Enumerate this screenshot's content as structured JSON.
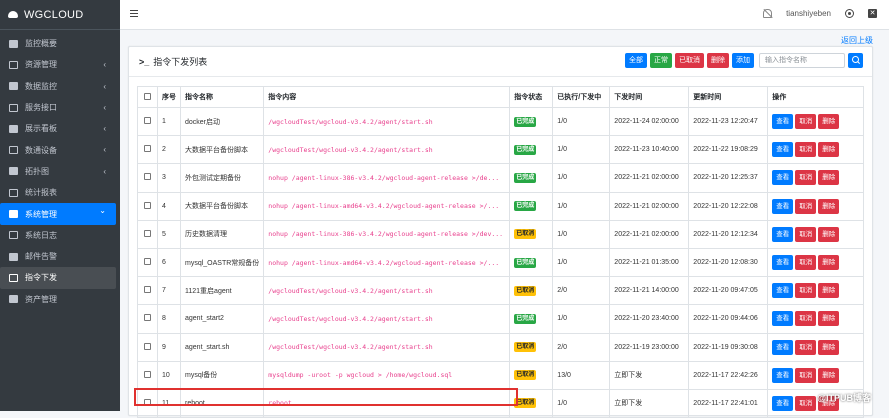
{
  "brand": "WGCLOUD",
  "sidebar": {
    "items": [
      {
        "label": "监控概要",
        "icon": "dashboard-icon",
        "arrow": false
      },
      {
        "label": "资源管理",
        "icon": "database-icon",
        "arrow": true
      },
      {
        "label": "数据监控",
        "icon": "chart-icon",
        "arrow": true
      },
      {
        "label": "服务接口",
        "icon": "link-icon",
        "arrow": true
      },
      {
        "label": "展示看板",
        "icon": "board-icon",
        "arrow": true
      },
      {
        "label": "数通设备",
        "icon": "network-icon",
        "arrow": true
      },
      {
        "label": "拓扑图",
        "icon": "topology-icon",
        "arrow": true
      },
      {
        "label": "统计报表",
        "icon": "pie-icon",
        "arrow": false
      },
      {
        "label": "系统管理",
        "icon": "system-icon",
        "arrow": true
      },
      {
        "label": "系统日志",
        "icon": "log-icon",
        "arrow": false
      },
      {
        "label": "邮件告警",
        "icon": "mail-icon",
        "arrow": false
      },
      {
        "label": "指令下发",
        "icon": "terminal-icon",
        "arrow": false
      },
      {
        "label": "资产管理",
        "icon": "asset-icon",
        "arrow": false
      }
    ]
  },
  "topbar": {
    "username": "tianshiyeben"
  },
  "back_link": "返回上级",
  "card": {
    "title": "指令下发列表",
    "buttons": {
      "all": "全部",
      "normal": "正常",
      "cancelled": "已取消",
      "delete": "删除",
      "add": "添加"
    },
    "search_placeholder": "输入指令名称"
  },
  "table": {
    "headers": [
      "序号",
      "指令名称",
      "指令内容",
      "指令状态",
      "已执行/下发中",
      "下发时间",
      "更新时间",
      "操作"
    ],
    "actions": {
      "view": "查看",
      "cancel": "取消",
      "delete": "删除"
    },
    "rows": [
      {
        "no": "1",
        "name": "docker启动",
        "cmd": "/wgcloudTest/wgcloud-v3.4.2/agent/start.sh",
        "status": "已完成",
        "status_type": "done",
        "exec": "1/0",
        "issue_time": "2022-11-24 02:00:00",
        "update_time": "2022-11-23 12:20:47"
      },
      {
        "no": "2",
        "name": "大数据平台备份脚本",
        "cmd": "/wgcloudTest/wgcloud-v3.4.2/agent/start.sh",
        "status": "已完成",
        "status_type": "done",
        "exec": "1/0",
        "issue_time": "2022-11-23 10:40:00",
        "update_time": "2022-11-22 19:08:29"
      },
      {
        "no": "3",
        "name": "外包测试定期备份",
        "cmd": "nohup /agent-linux-386-v3.4.2/wgcloud-agent-release >/de...",
        "status": "已完成",
        "status_type": "done",
        "exec": "1/0",
        "issue_time": "2022-11-21 02:00:00",
        "update_time": "2022-11-20 12:25:37"
      },
      {
        "no": "4",
        "name": "大数据平台备份脚本",
        "cmd": "nohup /agent-linux-amd64-v3.4.2/wgcloud-agent-release >/...",
        "status": "已完成",
        "status_type": "done",
        "exec": "1/0",
        "issue_time": "2022-11-21 02:00:00",
        "update_time": "2022-11-20 12:22:08"
      },
      {
        "no": "5",
        "name": "历史数据清理",
        "cmd": "nohup /agent-linux-386-v3.4.2/wgcloud-agent-release >/dev...",
        "status": "已取消",
        "status_type": "cancel",
        "exec": "1/0",
        "issue_time": "2022-11-21 02:00:00",
        "update_time": "2022-11-20 12:12:34"
      },
      {
        "no": "6",
        "name": "mysql_OASTR常规备份",
        "cmd": "nohup /agent-linux-amd64-v3.4.2/wgcloud-agent-release >/...",
        "status": "已完成",
        "status_type": "done",
        "exec": "1/0",
        "issue_time": "2022-11-21 01:35:00",
        "update_time": "2022-11-20 12:08:30"
      },
      {
        "no": "7",
        "name": "1121重启agent",
        "cmd": "/wgcloudTest/wgcloud-v3.4.2/agent/start.sh",
        "status": "已取消",
        "status_type": "cancel",
        "exec": "2/0",
        "issue_time": "2022-11-21 14:00:00",
        "update_time": "2022-11-20 09:47:05"
      },
      {
        "no": "8",
        "name": "agent_start2",
        "cmd": "/wgcloudTest/wgcloud-v3.4.2/agent/start.sh",
        "status": "已完成",
        "status_type": "done",
        "exec": "1/0",
        "issue_time": "2022-11-20 23:40:00",
        "update_time": "2022-11-20 09:44:06"
      },
      {
        "no": "9",
        "name": "agent_start.sh",
        "cmd": "/wgcloudTest/wgcloud-v3.4.2/agent/start.sh",
        "status": "已取消",
        "status_type": "cancel",
        "exec": "2/0",
        "issue_time": "2022-11-19 23:00:00",
        "update_time": "2022-11-19 09:30:08"
      },
      {
        "no": "10",
        "name": "mysql备份",
        "cmd": "mysqldump -uroot -p wgcloud > /home/wgcloud.sql",
        "status": "已取消",
        "status_type": "cancel",
        "exec": "13/0",
        "issue_time": "立即下发",
        "update_time": "2022-11-17 22:42:26"
      },
      {
        "no": "11",
        "name": "reboot",
        "cmd": "reboot",
        "status": "已取消",
        "status_type": "cancel",
        "exec": "1/0",
        "issue_time": "立即下发",
        "update_time": "2022-11-17 22:41:01"
      }
    ]
  },
  "watermark": "@ITPUB博客"
}
